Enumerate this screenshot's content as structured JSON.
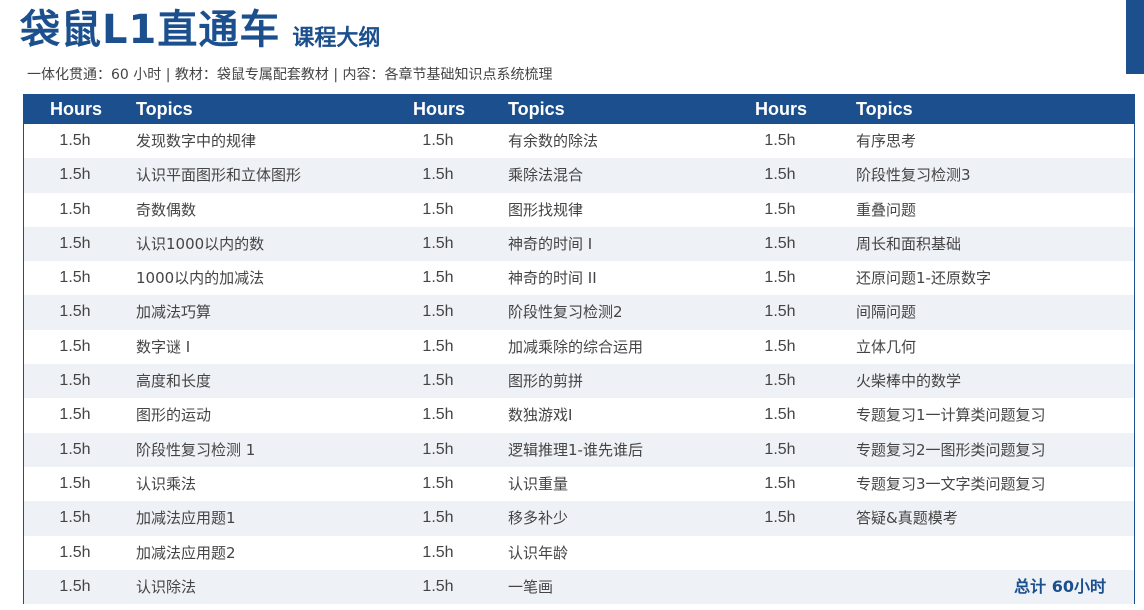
{
  "header": {
    "title": "袋鼠L1直通车",
    "subtitle": "课程大纲",
    "info": "一体化贯通：60 小时 | 教材：袋鼠专属配套教材 | 内容：各章节基础知识点系统梳理"
  },
  "table": {
    "columns": [
      "Hours",
      "Topics",
      "Hours",
      "Topics",
      "Hours",
      "Topics"
    ],
    "col1": [
      {
        "hours": "1.5h",
        "topic": "发现数字中的规律"
      },
      {
        "hours": "1.5h",
        "topic": "认识平面图形和立体图形"
      },
      {
        "hours": "1.5h",
        "topic": "奇数偶数"
      },
      {
        "hours": "1.5h",
        "topic": "认识1000以内的数"
      },
      {
        "hours": "1.5h",
        "topic": "1000以内的加减法"
      },
      {
        "hours": "1.5h",
        "topic": "加减法巧算"
      },
      {
        "hours": "1.5h",
        "topic": "数字谜 I"
      },
      {
        "hours": "1.5h",
        "topic": "高度和长度"
      },
      {
        "hours": "1.5h",
        "topic": "图形的运动"
      },
      {
        "hours": "1.5h",
        "topic": "阶段性复习检测 1"
      },
      {
        "hours": "1.5h",
        "topic": "认识乘法"
      },
      {
        "hours": "1.5h",
        "topic": "加减法应用题1"
      },
      {
        "hours": "1.5h",
        "topic": "加减法应用题2"
      },
      {
        "hours": "1.5h",
        "topic": "认识除法"
      }
    ],
    "col2": [
      {
        "hours": "1.5h",
        "topic": "有余数的除法"
      },
      {
        "hours": "1.5h",
        "topic": "乘除法混合"
      },
      {
        "hours": "1.5h",
        "topic": "图形找规律"
      },
      {
        "hours": "1.5h",
        "topic": "神奇的时间 I"
      },
      {
        "hours": "1.5h",
        "topic": "神奇的时间 II"
      },
      {
        "hours": "1.5h",
        "topic": "阶段性复习检测2"
      },
      {
        "hours": "1.5h",
        "topic": "加减乘除的综合运用"
      },
      {
        "hours": "1.5h",
        "topic": "图形的剪拼"
      },
      {
        "hours": "1.5h",
        "topic": "数独游戏I"
      },
      {
        "hours": "1.5h",
        "topic": "逻辑推理1-谁先谁后"
      },
      {
        "hours": "1.5h",
        "topic": "认识重量"
      },
      {
        "hours": "1.5h",
        "topic": "移多补少"
      },
      {
        "hours": "1.5h",
        "topic": "认识年龄"
      },
      {
        "hours": "1.5h",
        "topic": "一笔画"
      }
    ],
    "col3": [
      {
        "hours": "1.5h",
        "topic": "有序思考"
      },
      {
        "hours": "1.5h",
        "topic": "阶段性复习检测3"
      },
      {
        "hours": "1.5h",
        "topic": "重叠问题"
      },
      {
        "hours": "1.5h",
        "topic": "周长和面积基础"
      },
      {
        "hours": "1.5h",
        "topic": "还原问题1-还原数字"
      },
      {
        "hours": "1.5h",
        "topic": "间隔问题"
      },
      {
        "hours": "1.5h",
        "topic": "立体几何"
      },
      {
        "hours": "1.5h",
        "topic": "火柴棒中的数学"
      },
      {
        "hours": "1.5h",
        "topic": "专题复习1一计算类问题复习"
      },
      {
        "hours": "1.5h",
        "topic": "专题复习2一图形类问题复习"
      },
      {
        "hours": "1.5h",
        "topic": "专题复习3一文字类问题复习"
      },
      {
        "hours": "1.5h",
        "topic": "答疑&真题模考"
      }
    ],
    "total": "总计  60小时"
  }
}
